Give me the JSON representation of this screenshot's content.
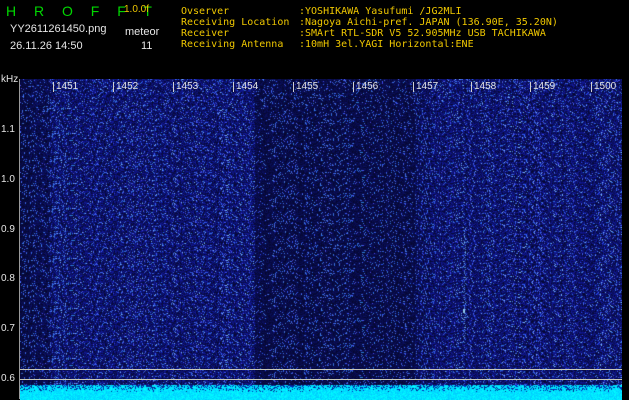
{
  "header": {
    "app_title": "H R O F F T",
    "version": "1.0.0f",
    "filename": "YY2611261450.png",
    "timestamp": "26.11.26 14:50",
    "mode_label": "meteor",
    "count": "11"
  },
  "info": {
    "observer_label": "Ovserver",
    "observer_value": ":YOSHIKAWA Yasufumi /JG2MLI",
    "location_label": "Receiving Location",
    "location_value": ":Nagoya Aichi-pref. JAPAN (136.90E, 35.20N)",
    "receiver_label": "Receiver",
    "receiver_value": ":SMArt RTL-SDR V5 52.905MHz USB TACHIKAWA",
    "antenna_label": "Receiving Antenna",
    "antenna_value": ":10mH 3el.YAGI Horizontal:ENE"
  },
  "axis": {
    "y_unit": "kHz",
    "y_ticks": [
      "1.1",
      "1.0",
      "0.9",
      "0.8",
      "0.7",
      "0.6"
    ],
    "x_ticks": [
      "1451",
      "1452",
      "1453",
      "1454",
      "1455",
      "1456",
      "1457",
      "1458",
      "1459",
      "1500"
    ]
  },
  "colors": {
    "background": "#000000",
    "spectrogram_blue": "#1e2cc8",
    "signal_cyan": "#00e0ff",
    "title_green": "#00d800",
    "label_yellow": "#f0c800"
  }
}
